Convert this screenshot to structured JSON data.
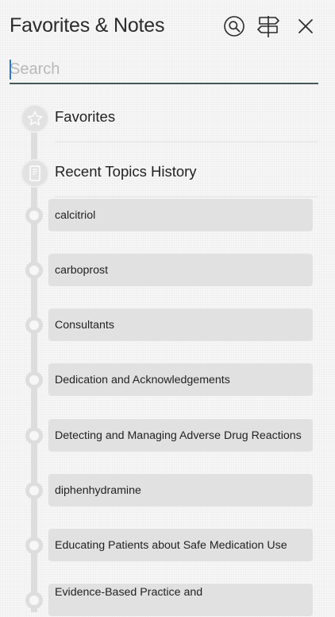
{
  "header": {
    "title": "Favorites & Notes",
    "search_icon": "search-icon",
    "signpost_icon": "signpost-icon",
    "close_icon": "close-icon"
  },
  "search": {
    "placeholder": "Search",
    "value": ""
  },
  "sections": {
    "favorites": {
      "label": "Favorites",
      "icon": "star-icon"
    },
    "history": {
      "label": "Recent Topics History",
      "icon": "document-icon"
    }
  },
  "history_items": [
    "calcitriol",
    "carboprost",
    "Consultants",
    "Dedication and Acknowledgements",
    "Detecting and Managing Adverse Drug Reactions",
    "diphenhydramine",
    "Educating Patients about Safe Medication Use",
    "Evidence-Based Practice and"
  ],
  "colors": {
    "background": "#f7f7f7",
    "pill": "#e1e1e1",
    "timeline": "#dddddd",
    "search_underline": "#45575a",
    "caret": "#3c73b8"
  }
}
